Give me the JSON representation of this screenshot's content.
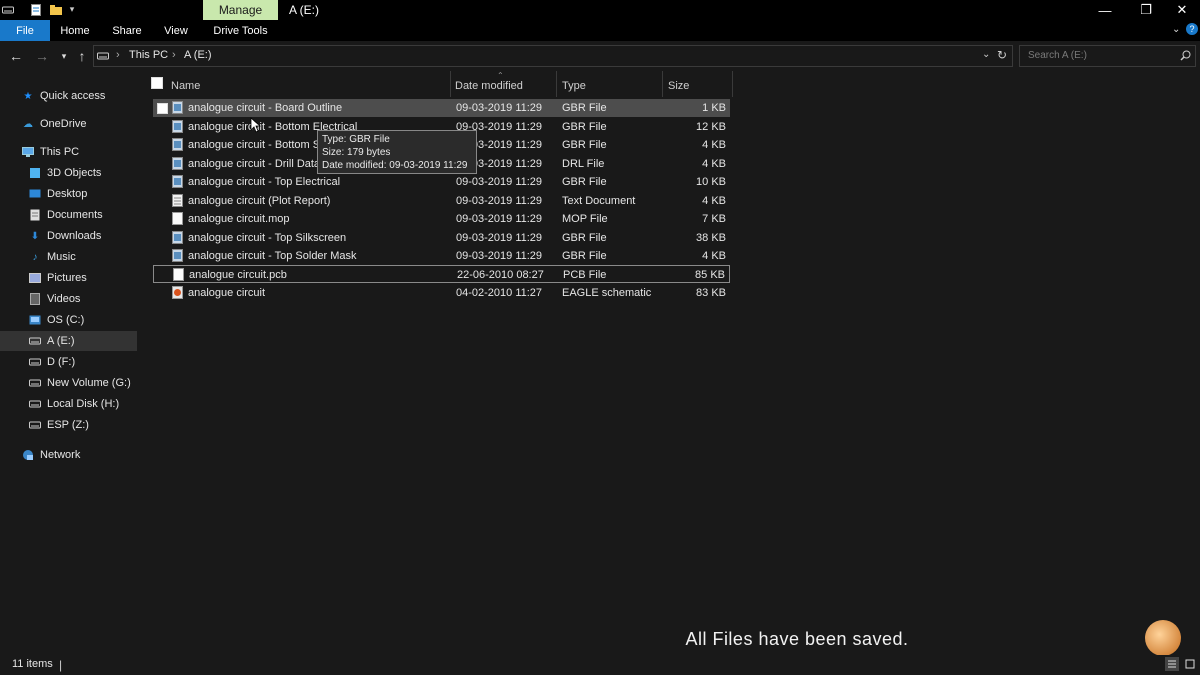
{
  "window": {
    "title": "A (E:)",
    "context_tab": "Manage",
    "controls": {
      "minimize": "—",
      "restore": "❐",
      "close": "✕"
    }
  },
  "ribbon": {
    "tabs": [
      {
        "label": "File"
      },
      {
        "label": "Home"
      },
      {
        "label": "Share"
      },
      {
        "label": "View"
      },
      {
        "label": "Drive Tools"
      }
    ]
  },
  "address": {
    "breadcrumb": [
      "This PC",
      "A (E:)"
    ],
    "search_placeholder": "Search A (E:)"
  },
  "nav": {
    "items": [
      {
        "label": "Quick access",
        "icon": "star-icon"
      },
      {
        "label": "OneDrive",
        "icon": "cloud-icon"
      },
      {
        "label": "This PC",
        "icon": "computer-icon"
      },
      {
        "label": "3D Objects",
        "icon": "cube-icon"
      },
      {
        "label": "Desktop",
        "icon": "desktop-icon"
      },
      {
        "label": "Documents",
        "icon": "document-icon"
      },
      {
        "label": "Downloads",
        "icon": "download-icon"
      },
      {
        "label": "Music",
        "icon": "music-icon"
      },
      {
        "label": "Pictures",
        "icon": "pictures-icon"
      },
      {
        "label": "Videos",
        "icon": "videos-icon"
      },
      {
        "label": "OS (C:)",
        "icon": "drive-icon"
      },
      {
        "label": "A (E:)",
        "icon": "drive-icon",
        "selected": true
      },
      {
        "label": "D (F:)",
        "icon": "drive-icon"
      },
      {
        "label": "New Volume (G:)",
        "icon": "drive-icon"
      },
      {
        "label": "Local Disk (H:)",
        "icon": "drive-icon"
      },
      {
        "label": "ESP (Z:)",
        "icon": "drive-icon"
      },
      {
        "label": "Network",
        "icon": "network-icon"
      }
    ]
  },
  "columns": {
    "name": "Name",
    "date": "Date modified",
    "type": "Type",
    "size": "Size"
  },
  "files": [
    {
      "name": "analogue circuit - Board Outline",
      "date": "09-03-2019 11:29",
      "type": "GBR File",
      "size": "1 KB",
      "icon": "gbr"
    },
    {
      "name": "analogue circuit - Bottom Electrical",
      "date": "09-03-2019 11:29",
      "type": "GBR File",
      "size": "12 KB",
      "icon": "gbr"
    },
    {
      "name": "analogue circuit - Bottom Silkscreen",
      "date": "09-03-2019 11:29",
      "type": "GBR File",
      "size": "4 KB",
      "icon": "gbr"
    },
    {
      "name": "analogue circuit - Drill Data",
      "date": "09-03-2019 11:29",
      "type": "DRL File",
      "size": "4 KB",
      "icon": "gbr"
    },
    {
      "name": "analogue circuit - Top Electrical",
      "date": "09-03-2019 11:29",
      "type": "GBR File",
      "size": "10 KB",
      "icon": "gbr"
    },
    {
      "name": "analogue circuit (Plot Report)",
      "date": "09-03-2019 11:29",
      "type": "Text Document",
      "size": "4 KB",
      "icon": "txt"
    },
    {
      "name": "analogue circuit.mop",
      "date": "09-03-2019 11:29",
      "type": "MOP File",
      "size": "7 KB",
      "icon": "blank"
    },
    {
      "name": "analogue circuit - Top Silkscreen",
      "date": "09-03-2019 11:29",
      "type": "GBR File",
      "size": "38 KB",
      "icon": "gbr"
    },
    {
      "name": "analogue circuit - Top Solder Mask",
      "date": "09-03-2019 11:29",
      "type": "GBR File",
      "size": "4 KB",
      "icon": "gbr"
    },
    {
      "name": "analogue circuit.pcb",
      "date": "22-06-2010 08:27",
      "type": "PCB File",
      "size": "85 KB",
      "icon": "blank"
    },
    {
      "name": "analogue circuit",
      "date": "04-02-2010 11:27",
      "type": "EAGLE schematic",
      "size": "83 KB",
      "icon": "eagle"
    }
  ],
  "tooltip": {
    "type_line": "Type: GBR File",
    "size_line": "Size: 179 bytes",
    "date_line": "Date modified: 09-03-2019 11:29"
  },
  "caption": "All Files have been saved.",
  "status": {
    "items": "11 items"
  }
}
